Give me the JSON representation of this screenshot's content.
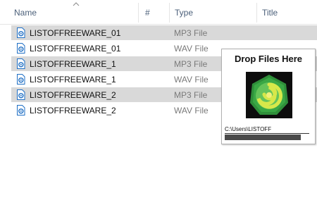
{
  "columns": {
    "name": "Name",
    "number": "#",
    "type": "Type",
    "title": "Title"
  },
  "files": [
    {
      "name": "LISTOFFREEWARE_01",
      "type": "MP3 File",
      "selected": true
    },
    {
      "name": "LISTOFFREEWARE_01",
      "type": "WAV File",
      "selected": false
    },
    {
      "name": "LISTOFFREEWARE_1",
      "type": "MP3 File",
      "selected": true
    },
    {
      "name": "LISTOFFREEWARE_1",
      "type": "WAV File",
      "selected": false
    },
    {
      "name": "LISTOFFREEWARE_2",
      "type": "MP3 File",
      "selected": true
    },
    {
      "name": "LISTOFFREEWARE_2",
      "type": "WAV File",
      "selected": false
    }
  ],
  "drop_panel": {
    "title": "Drop Files Here",
    "path": "C:\\Users\\LISTOFF",
    "logo_icon": "swirl-logo-icon"
  },
  "colors": {
    "header_text": "#4c607a",
    "selected_row": "#d9d9d9",
    "file_icon": "#1f6fc5",
    "logo_green": "#2f8f3a"
  }
}
